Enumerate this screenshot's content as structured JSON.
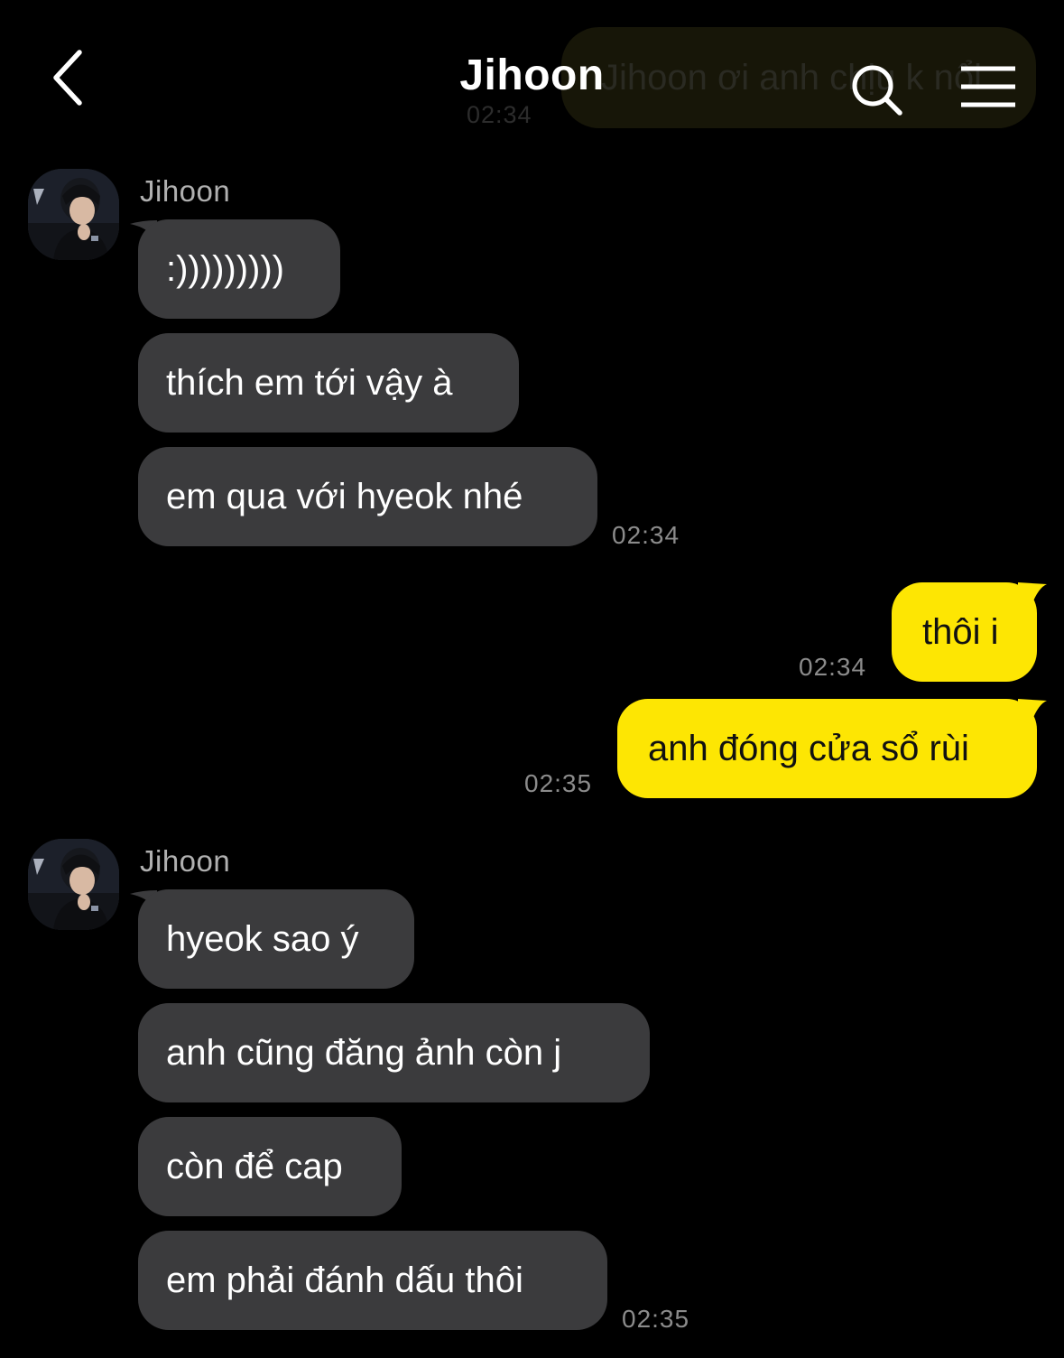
{
  "header": {
    "title": "Jihoon",
    "background_preview_text": "Jihoon ơi anh chịu k nổi",
    "background_preview_time": "02:34"
  },
  "icons": {
    "back": "chevron-left-icon",
    "search": "search-icon",
    "menu": "hamburger-menu-icon"
  },
  "colors": {
    "background": "#000000",
    "incoming_bubble": "#3b3b3d",
    "outgoing_bubble": "#fde603",
    "timestamp": "#8b8b8b"
  },
  "groups": [
    {
      "sender": "Jihoon",
      "messages": [
        ":)))))))))",
        "thích em tới vậy à",
        "em qua với hyeok nhé"
      ],
      "time": "02:34"
    },
    {
      "sender": "me",
      "messages": [
        "thôi i"
      ],
      "time": "02:34"
    },
    {
      "sender": "me",
      "messages": [
        "anh đóng cửa sổ rùi"
      ],
      "time": "02:35"
    },
    {
      "sender": "Jihoon",
      "messages": [
        "hyeok sao ý",
        "anh cũng đăng ảnh còn j",
        "còn để cap",
        "em phải đánh dấu thôi"
      ],
      "time": "02:35"
    }
  ]
}
